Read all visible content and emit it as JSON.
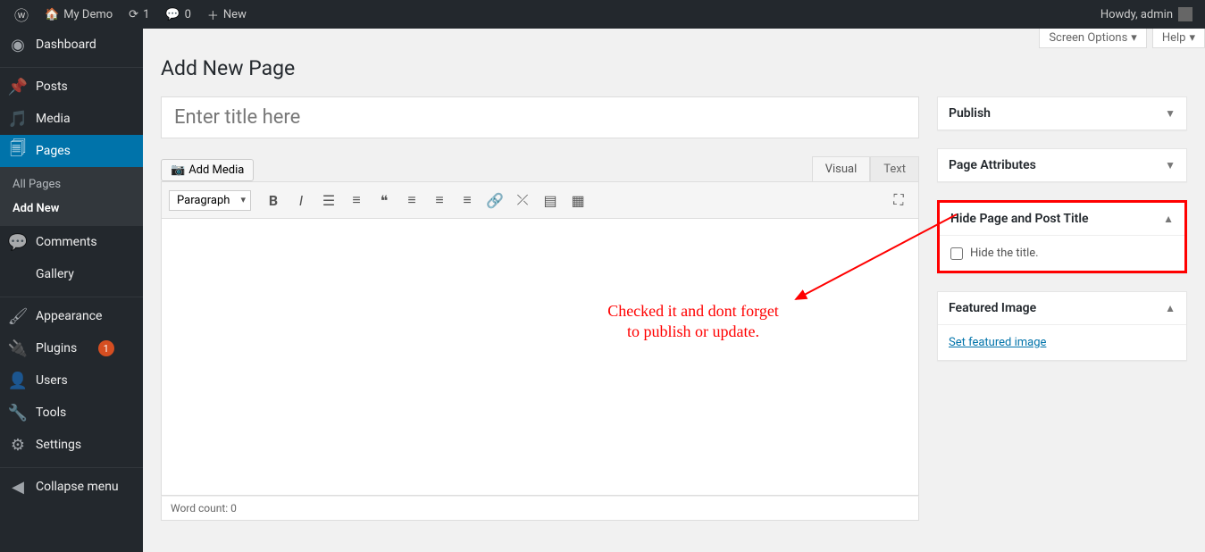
{
  "adminbar": {
    "site_name": "My Demo",
    "updates": "1",
    "comments": "0",
    "new_label": "New",
    "greeting": "Howdy, admin"
  },
  "sidebar": {
    "dashboard": "Dashboard",
    "posts": "Posts",
    "media": "Media",
    "pages": "Pages",
    "pages_sub_all": "All Pages",
    "pages_sub_add": "Add New",
    "comments": "Comments",
    "gallery": "Gallery",
    "appearance": "Appearance",
    "plugins": "Plugins",
    "plugins_badge": "1",
    "users": "Users",
    "tools": "Tools",
    "settings": "Settings",
    "collapse": "Collapse menu"
  },
  "screen_options": "Screen Options",
  "help": "Help",
  "page_title": "Add New Page",
  "title_placeholder": "Enter title here",
  "add_media": "Add Media",
  "tab_visual": "Visual",
  "tab_text": "Text",
  "format_selected": "Paragraph",
  "word_count": "Word count: 0",
  "boxes": {
    "publish": "Publish",
    "page_attributes": "Page Attributes",
    "hide_title_box": "Hide Page and Post Title",
    "hide_title_checkbox": "Hide the title.",
    "featured_image": "Featured Image",
    "set_featured": "Set featured image"
  },
  "annotation": "Checked it and dont forget\nto publish or update."
}
